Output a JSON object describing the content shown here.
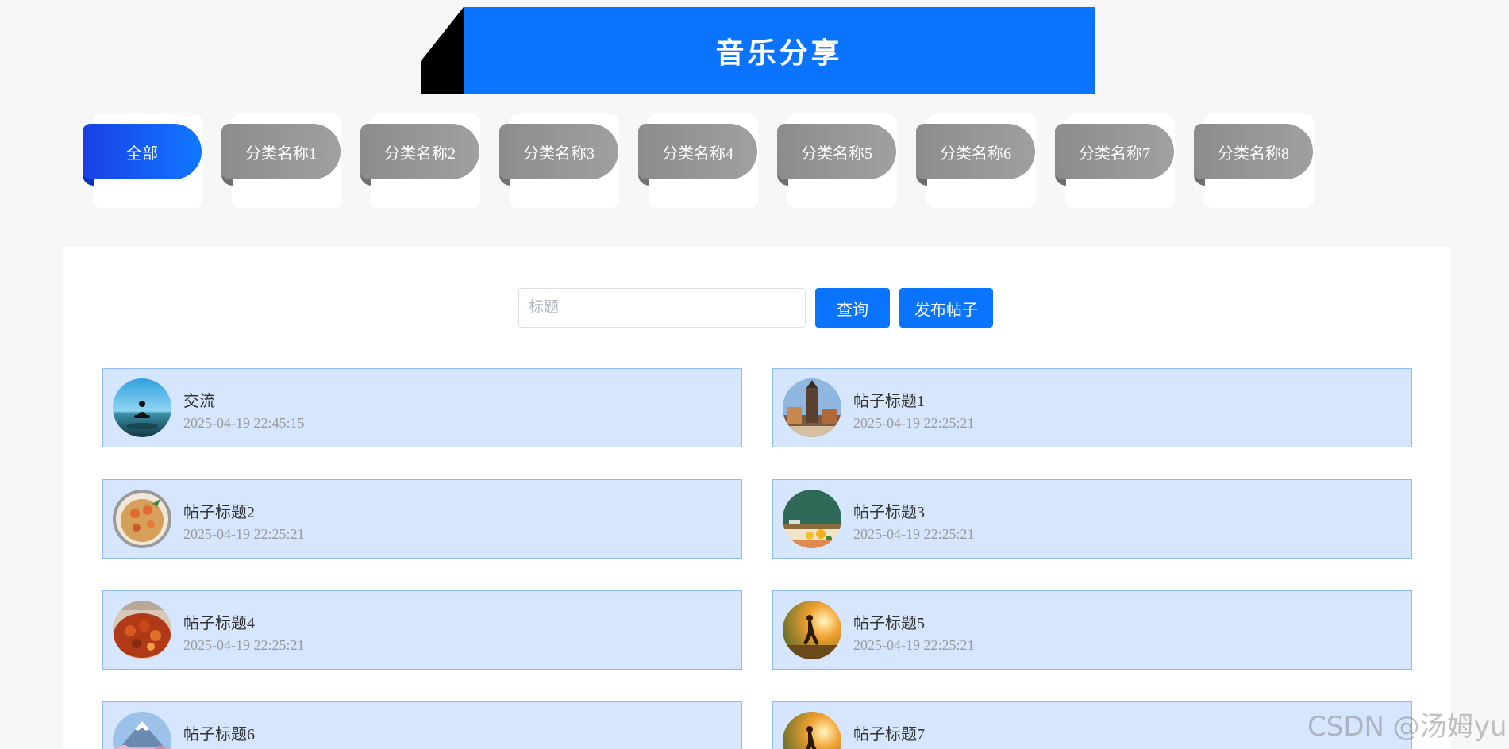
{
  "banner": {
    "title": "音乐分享"
  },
  "categories": [
    {
      "label": "全部",
      "active": true
    },
    {
      "label": "分类名称1",
      "active": false
    },
    {
      "label": "分类名称2",
      "active": false
    },
    {
      "label": "分类名称3",
      "active": false
    },
    {
      "label": "分类名称4",
      "active": false
    },
    {
      "label": "分类名称5",
      "active": false
    },
    {
      "label": "分类名称6",
      "active": false
    },
    {
      "label": "分类名称7",
      "active": false
    },
    {
      "label": "分类名称8",
      "active": false
    }
  ],
  "search": {
    "placeholder": "标题",
    "value": "",
    "query_label": "查询",
    "publish_label": "发布帖子"
  },
  "posts": [
    {
      "title": "交流",
      "time": "2025-04-19 22:45:15",
      "thumb": "meditation-sea"
    },
    {
      "title": "帖子标题1",
      "time": "2025-04-19 22:25:21",
      "thumb": "tower-city"
    },
    {
      "title": "帖子标题2",
      "time": "2025-04-19 22:25:21",
      "thumb": "shrimp-dish"
    },
    {
      "title": "帖子标题3",
      "time": "2025-04-19 22:25:21",
      "thumb": "classroom-board"
    },
    {
      "title": "帖子标题4",
      "time": "2025-04-19 22:25:21",
      "thumb": "crayfish-dish"
    },
    {
      "title": "帖子标题5",
      "time": "2025-04-19 22:25:21",
      "thumb": "runner-sunset"
    },
    {
      "title": "帖子标题6",
      "time": "",
      "thumb": "fuji-blossom"
    },
    {
      "title": "帖子标题7",
      "time": "",
      "thumb": "runner-sunset"
    }
  ],
  "watermark": "CSDN @汤姆yu",
  "colors": {
    "primary": "#0a74ff",
    "post_bg": "#d7e6ff",
    "post_border": "#8fbaf5",
    "inactive_tab": "#999999"
  }
}
